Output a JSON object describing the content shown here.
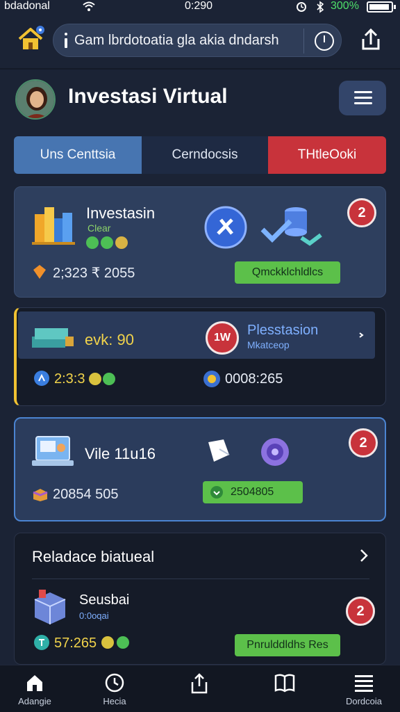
{
  "status_bar": {
    "carrier": "bdadonal",
    "time": "0:290",
    "battery_pct": "300%"
  },
  "browser": {
    "url_text": "Gam lbrdotoatia gla akia dndarsh"
  },
  "header": {
    "title": "Investasi Virtual"
  },
  "tabs": [
    {
      "label": "Uns Centtsia"
    },
    {
      "label": "Cerndocsis"
    },
    {
      "label": "THtleOoki"
    }
  ],
  "cards": {
    "investasin": {
      "title": "Investasin",
      "subtitle": "Clear",
      "amount": "2;323 ₹ 2055",
      "action_label": "Qmckklchldlcs",
      "badge": "2"
    },
    "plesstasion": {
      "label": "evk: 90",
      "badge": "1W",
      "title": "Plesstasion",
      "subtitle": "Mkatceop",
      "left_amount": "2:3:3",
      "right_amount": "0008:265"
    },
    "vile": {
      "title": "Vile 11u16",
      "amount": "20854 505",
      "action_label": "2504805",
      "badge": "2"
    }
  },
  "related": {
    "title": "Reladace biatueal",
    "item": {
      "title": "Seusbai",
      "subtitle": "0:0oqai",
      "amount": "57:265",
      "action_label": "Pnrulddldhs Res",
      "badge": "2"
    }
  },
  "bottom_nav": [
    {
      "label": "Adangie"
    },
    {
      "label": "Hecia"
    },
    {
      "label": ""
    },
    {
      "label": ""
    },
    {
      "label": "Dordcoia"
    }
  ],
  "colors": {
    "background": "#1b2335",
    "accent_blue": "#4775b1",
    "accent_red": "#c8333b",
    "accent_green": "#5cc04a",
    "accent_yellow": "#f1c232"
  }
}
